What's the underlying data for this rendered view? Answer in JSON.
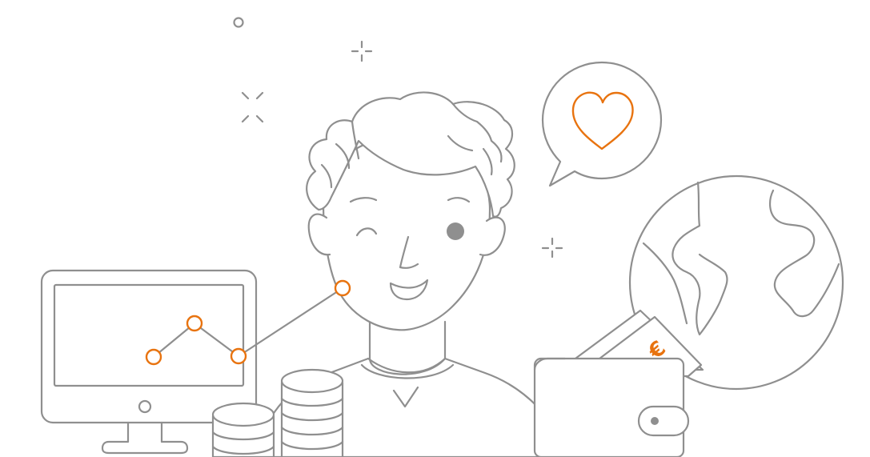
{
  "colors": {
    "line": "#8f8f8f",
    "accent": "#e8730f",
    "eye_fill": "#8f8f8f",
    "background": "#ffffff"
  },
  "wallet": {
    "currency_symbol": "€"
  },
  "icons": [
    "heart-icon",
    "speech-bubble-icon",
    "globe-icon",
    "wallet-icon",
    "monitor-icon",
    "line-chart-icon",
    "coin-stack-icon",
    "sparkle-icon"
  ]
}
